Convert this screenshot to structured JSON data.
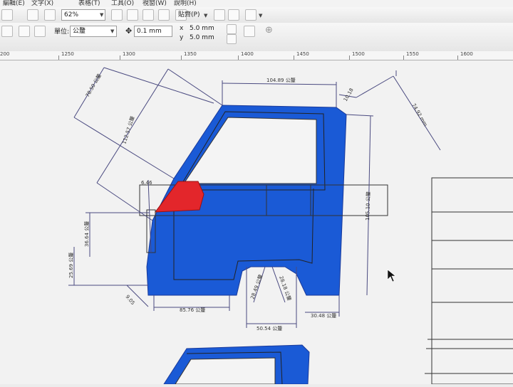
{
  "menu": {
    "items": [
      "編輯(E)",
      "文字(X)",
      "表格(T)",
      "工具(O)",
      "視窗(W)",
      "說明(H)"
    ]
  },
  "toolbar": {
    "zoom_value": "62%",
    "snap_label": "貼齊(P)",
    "unit_label": "單位:",
    "unit_value": "公釐",
    "nudge_value": "0.1 mm",
    "dup_x_label": "x",
    "dup_x_value": "5.0 mm",
    "dup_y_label": "y",
    "dup_y_value": "5.0 mm"
  },
  "ruler": {
    "labels": [
      "200",
      "1250",
      "1300",
      "1350",
      "1400",
      "1450",
      "1500",
      "1550",
      "1600"
    ]
  },
  "dimensions": {
    "d1": "78.50 公釐",
    "d2": "112.57 公釐",
    "d3": "104.89 公釐",
    "d4": "10.18",
    "d5": "74.92 mm",
    "d6": "105.10 公釐",
    "d7": "36.64 公釐",
    "d8": "25.69 公釐",
    "d9": "6.46",
    "d10": "9.05",
    "d11": "85.76 公釐",
    "d12": "28.49 公釐",
    "d13": "28.18 公釐",
    "d14": "50.54 公釐",
    "d15": "30.48 公釐"
  },
  "colors": {
    "shape_blue": "#1a5ad6",
    "shape_red": "#e3262b",
    "dimension_line": "#4a4a80"
  }
}
